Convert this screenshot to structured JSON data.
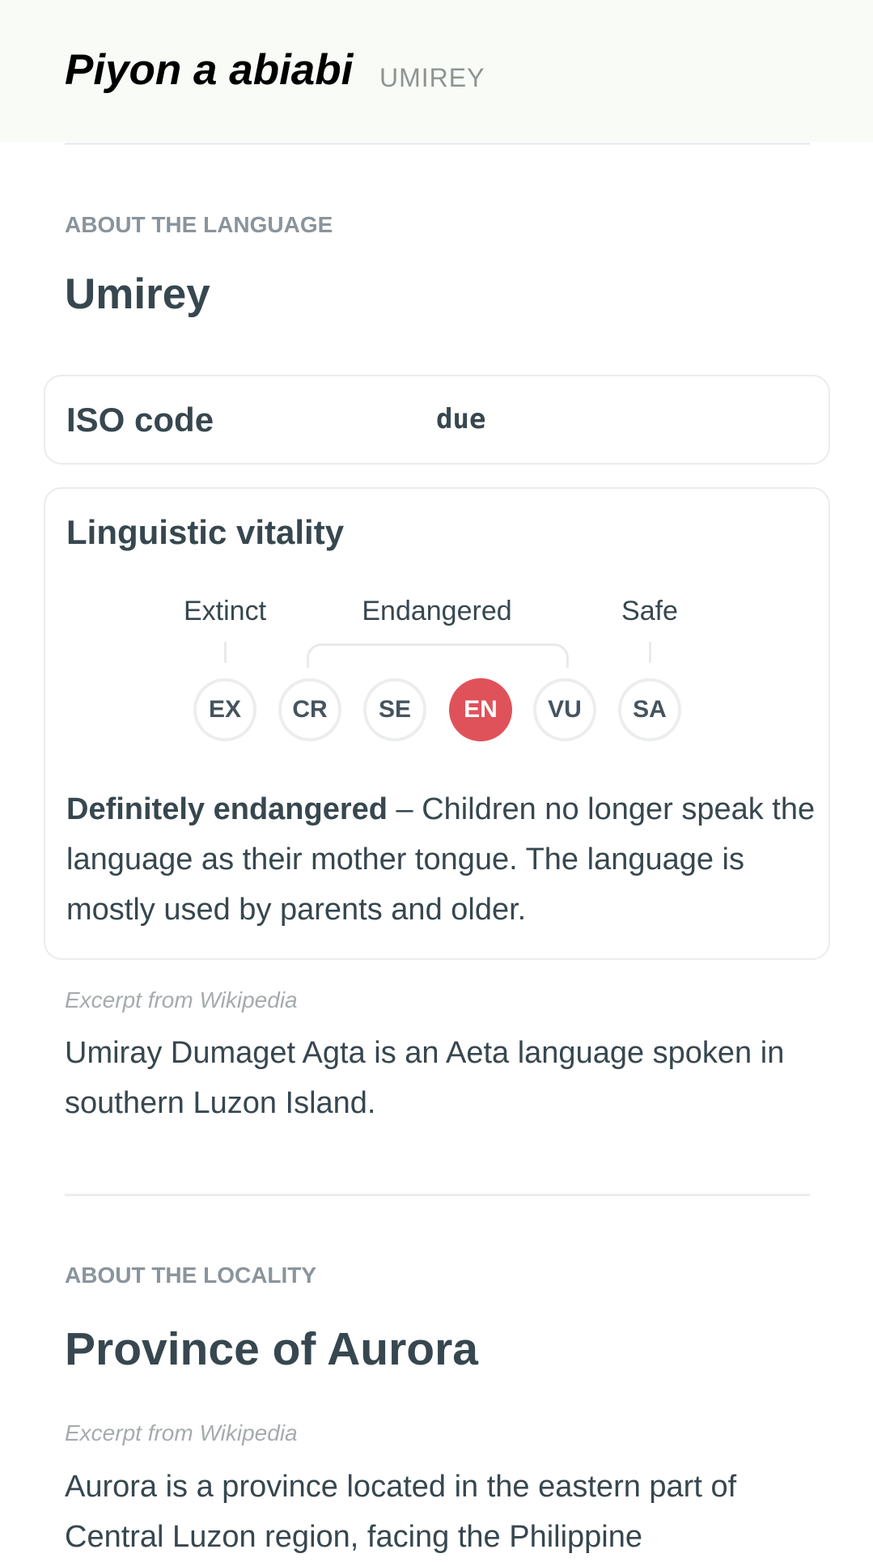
{
  "header": {
    "title": "Piyon a abiabi",
    "subtitle": "UMIREY"
  },
  "language": {
    "section_label": "ABOUT THE LANGUAGE",
    "name": "Umirey",
    "iso": {
      "label": "ISO code",
      "value": "due"
    },
    "vitality": {
      "title": "Linguistic vitality",
      "groups": [
        "Extinct",
        "Endangered",
        "Safe"
      ],
      "levels": [
        {
          "code": "EX",
          "active": false
        },
        {
          "code": "CR",
          "active": false
        },
        {
          "code": "SE",
          "active": false
        },
        {
          "code": "EN",
          "active": true
        },
        {
          "code": "VU",
          "active": false
        },
        {
          "code": "SA",
          "active": false
        }
      ],
      "active_color": "#e0525a",
      "status": "Definitely endangered",
      "separator": " – ",
      "description": "Children no longer speak the language as their mother tongue. The language is mostly used by parents and older."
    },
    "excerpt_label": "Excerpt from Wikipedia",
    "excerpt": "Umiray Dumaget Agta is an Aeta language spoken in southern Luzon Island."
  },
  "locality": {
    "section_label": "ABOUT THE LOCALITY",
    "name": "Province of Aurora",
    "excerpt_label": "Excerpt from Wikipedia",
    "excerpt": "Aurora is a province located in the eastern part of Central Luzon region, facing the Philippine"
  }
}
